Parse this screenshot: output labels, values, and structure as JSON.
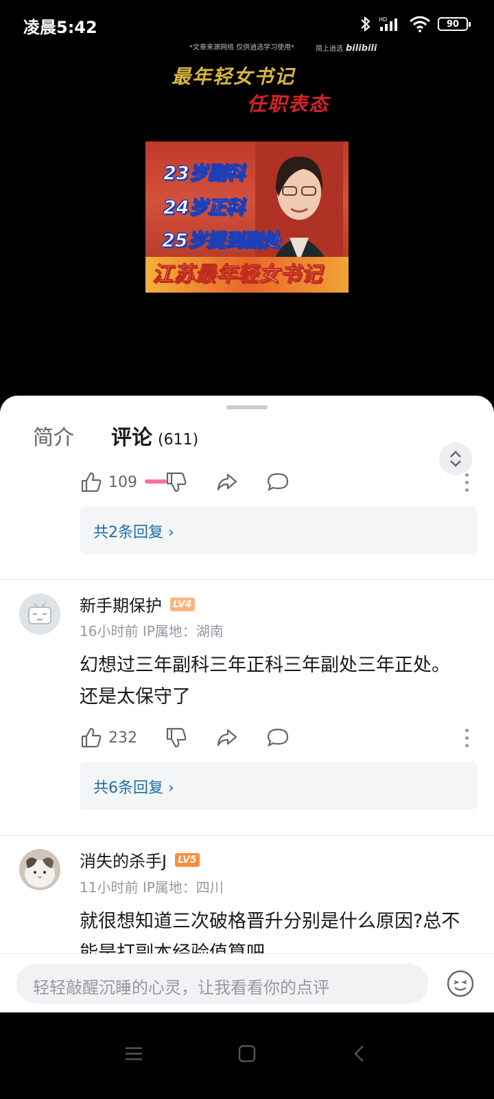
{
  "status_bar": {
    "time": "凌晨5:42",
    "battery": "90"
  },
  "video": {
    "watermark": "*文章来源网络 仅供逍选学习使用*",
    "source_tag": "简上逍选",
    "brand": "bilibili",
    "title_line1": "最年轻女书记",
    "title_line2": "任职表态",
    "thumb_line1": "23岁副科",
    "thumb_line2": "24岁正科",
    "thumb_line3": "25岁提到副处",
    "thumb_banner": "江苏最年轻女书记"
  },
  "tabs": {
    "intro": "简介",
    "comments": "评论",
    "comments_count": "(611)"
  },
  "comments": [
    {
      "likes": "109",
      "replies": "共2条回复"
    },
    {
      "username": "新手期保护",
      "level": "LV4",
      "time": "16小时前",
      "ip": "IP属地：湖南",
      "text": "幻想过三年副科三年正科三年副处三年正处。还是太保守了",
      "likes": "232",
      "replies": "共6条回复"
    },
    {
      "username": "消失的杀手J",
      "level": "LV5",
      "time": "11小时前",
      "ip": "IP属地：四川",
      "text": "就很想知道三次破格晋升分别是什么原因?总不能是打副本经验值算吧"
    }
  ],
  "input": {
    "placeholder": "轻轻敲醒沉睡的心灵，让我看看你的点评"
  },
  "colors": {
    "accent_pink": "#fb7299",
    "reply_link": "#1b6ea8",
    "lv4": "#ffb37c",
    "lv5": "#ff8c3a"
  }
}
